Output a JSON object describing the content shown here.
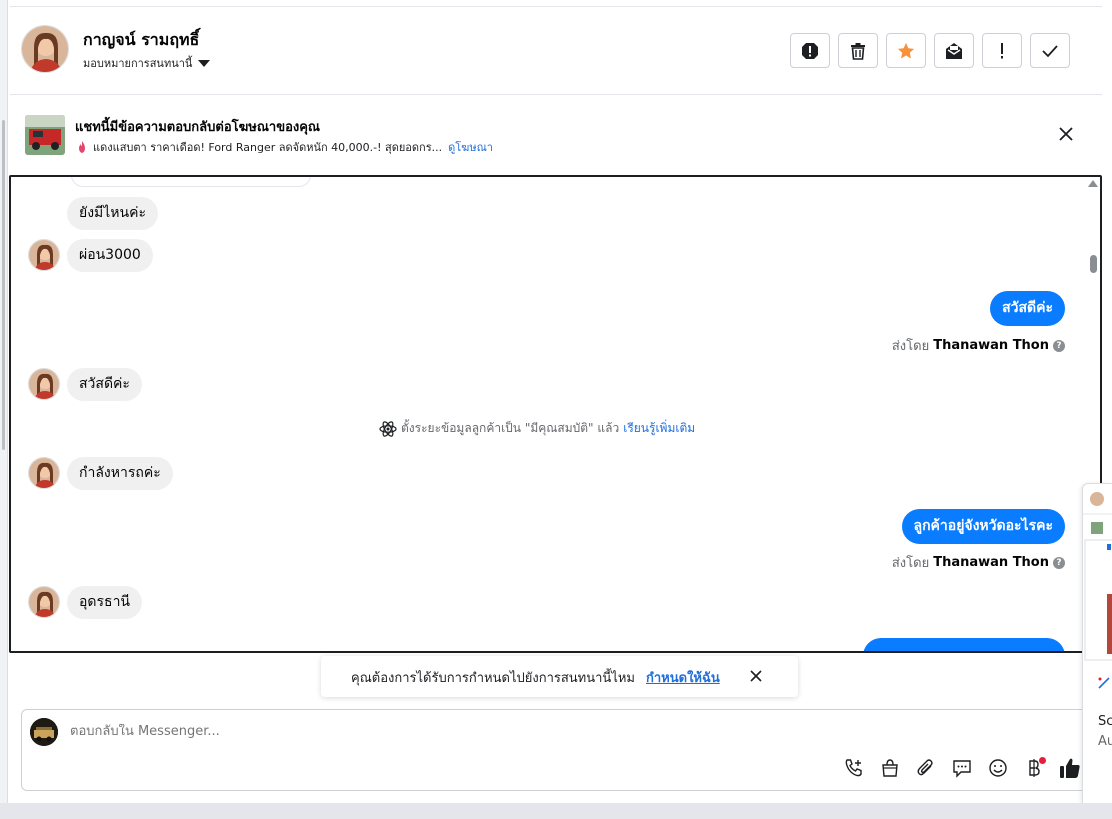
{
  "header": {
    "name": "กาญจน์ รามฤทธิ์",
    "assign_label": "มอบหมายการสนทนานี้",
    "tools": [
      {
        "icon": "spam-alert-icon"
      },
      {
        "icon": "trash-icon"
      },
      {
        "icon": "star-icon"
      },
      {
        "icon": "mark-unread-icon"
      },
      {
        "icon": "exclamation-icon"
      },
      {
        "icon": "check-icon"
      }
    ]
  },
  "ad": {
    "title": "แชทนี้มีข้อความตอบกลับต่อโฆษณาของคุณ",
    "subtitle": "แดงแสบตา ราคาเดือด! Ford Ranger ลดจัดหนัก 40,000.-! สุดยอดกร...",
    "link": "ดูโฆษณา"
  },
  "messages": {
    "m1": "ยังมีไหนค่ะ",
    "m2": "ผ่อน3000",
    "m3": "สวัสดีค่ะ",
    "m4": "สวัสดีค่ะ",
    "m5": "กำลังหารถค่ะ",
    "m6": "ลูกค้าอยู่จังหวัดอะไรคะ",
    "m7": "อุดรธานี",
    "sent_by_prefix": "ส่งโดย",
    "sent_by_name": "Thanawan Thon",
    "system_text": "ตั้งระยะข้อมูลลูกค้าเป็น \"มีคุณสมบัติ\" แล้ว",
    "system_link": "เรียนรู้เพิ่มเติม"
  },
  "toast": {
    "text": "คุณต้องการได้รับการกำหนดไปยังการสนทนานี้ไหม",
    "link": "กำหนดให้ฉัน"
  },
  "composer": {
    "placeholder": "ตอบกลับใน Messenger..."
  },
  "side_popup": {
    "line1": "Sc",
    "line2": "Au"
  },
  "colors": {
    "accent": "#0a7cff",
    "link": "#216fdb",
    "star": "#f7923b"
  }
}
